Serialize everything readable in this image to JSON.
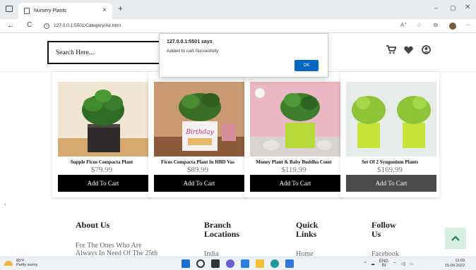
{
  "browser": {
    "tab_title": "Nursery Plants",
    "tab_close": "×",
    "new_tab": "+",
    "url": "127.0.0.1:5501/Category/Air.html",
    "win_min": "–",
    "win_max": "▢",
    "win_close": "✕",
    "back": "←",
    "reload": "C",
    "info": "i",
    "more": "···"
  },
  "header": {
    "search_placeholder": "Search Here...",
    "cart_icon": "cart-icon",
    "wishlist_icon": "heart-icon",
    "account_icon": "user-icon"
  },
  "dialog": {
    "title": "127.0.0.1:5501 says",
    "message": "Added to cart Succesfully",
    "ok_label": "OK"
  },
  "products": [
    {
      "name": "Supple Ficus Compacta Plant",
      "price": "$79.99",
      "button": "Add To Cart"
    },
    {
      "name": "Ficus Compacta Plant In HBD Vas",
      "price": "$89.99",
      "button": "Add To Cart"
    },
    {
      "name": "Money Plant & Baby Buddha Comt",
      "price": "$119.99",
      "button": "Add To Cart"
    },
    {
      "name": "Set Of 2 Syngonium Plants",
      "price": "$169.99",
      "button": "Add To Cart"
    }
  ],
  "footer": {
    "about": {
      "heading": "About Us",
      "text1": "For The Ones Who Are",
      "text2": "Always In Need Of The 25th"
    },
    "branch": {
      "heading1": "Branch",
      "heading2": "Locations",
      "item": "India"
    },
    "quick": {
      "heading1": "Quick",
      "heading2": "Links",
      "item": "Home"
    },
    "follow": {
      "heading1": "Follow",
      "heading2": "Us",
      "item": "Facebook"
    },
    "scroll_top": "^"
  },
  "taskbar": {
    "temp": "85°F",
    "weather": "Partly sunny",
    "lang1": "ENG",
    "lang2": "IN",
    "time": "12:09",
    "date": "15-09-2022"
  },
  "colors": {
    "button_black": "#000000",
    "ok_blue": "#0067c0",
    "scroll_top_bg": "#d6efe3"
  }
}
